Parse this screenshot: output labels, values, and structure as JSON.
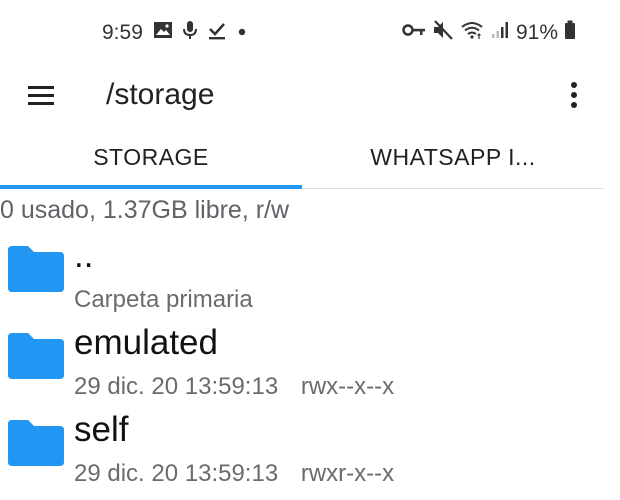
{
  "statusbar": {
    "time": "9:59",
    "battery": "91%",
    "icons_left": [
      "image-icon",
      "mic-icon",
      "check-download-icon",
      "dot-icon"
    ],
    "icons_right": [
      "key-icon",
      "mute-icon",
      "wifi-icon",
      "signal-icon",
      "battery-icon"
    ]
  },
  "toolbar": {
    "path": "/storage"
  },
  "tabs": [
    {
      "label": "STORAGE",
      "active": true
    },
    {
      "label": "WHATSAPP I...",
      "active": false
    }
  ],
  "summary": "0 usado, 1.37GB libre, r/w",
  "files": [
    {
      "name": "..",
      "meta": "Carpeta primaria",
      "perms": ""
    },
    {
      "name": "emulated",
      "meta": "29 dic. 20 13:59:13",
      "perms": "rwx--x--x"
    },
    {
      "name": "self",
      "meta": "29 dic. 20 13:59:13",
      "perms": "rwxr-x--x"
    }
  ],
  "colors": {
    "accent": "#2196f3",
    "folder": "#2196f3"
  }
}
